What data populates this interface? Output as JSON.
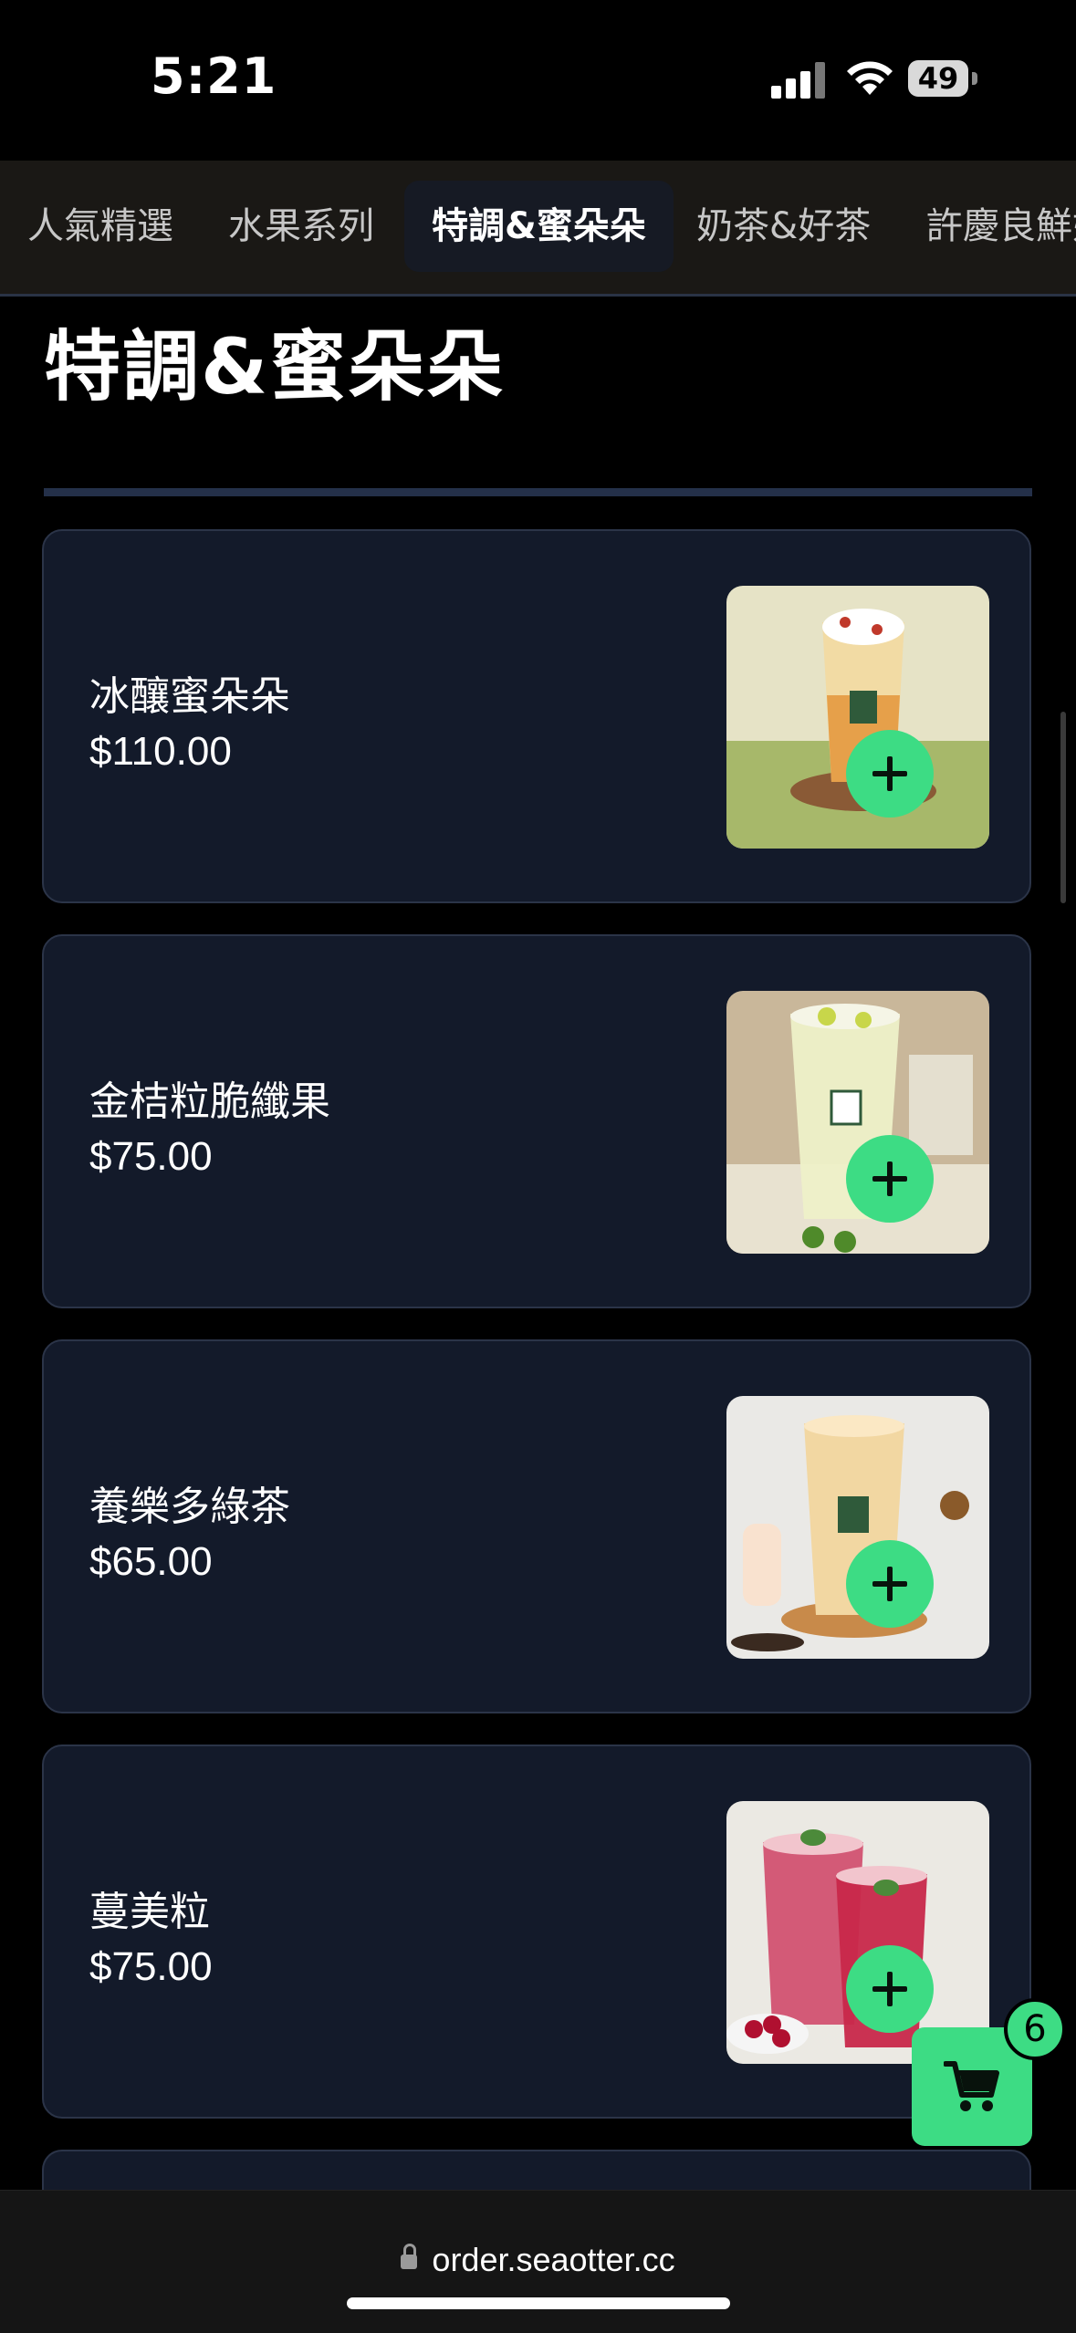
{
  "status_bar": {
    "time": "5:21",
    "battery": "49"
  },
  "tabs": [
    {
      "label": "人氣精選",
      "active": false
    },
    {
      "label": "水果系列",
      "active": false
    },
    {
      "label": "特調&蜜朵朵",
      "active": true
    },
    {
      "label": "奶茶&好茶",
      "active": false
    },
    {
      "label": "許慶良鮮奶",
      "active": false
    }
  ],
  "section": {
    "title": "特調&蜜朵朵"
  },
  "products": [
    {
      "name": "冰釀蜜朵朵",
      "price": "$110.00",
      "image_icon": "honey-drink-photo"
    },
    {
      "name": "金桔粒脆纖果",
      "price": "$75.00",
      "image_icon": "kumquat-drink-photo"
    },
    {
      "name": "養樂多綠茶",
      "price": "$65.00",
      "image_icon": "yakult-green-tea-photo"
    },
    {
      "name": "蔓美粒",
      "price": "$75.00",
      "image_icon": "cranberry-drink-photo"
    }
  ],
  "cart": {
    "count": "6"
  },
  "browser": {
    "url": "order.seaotter.cc"
  },
  "colors": {
    "accent": "#3ddc84",
    "card_bg": "#131a2a",
    "tabs_bg": "#1a1815"
  }
}
